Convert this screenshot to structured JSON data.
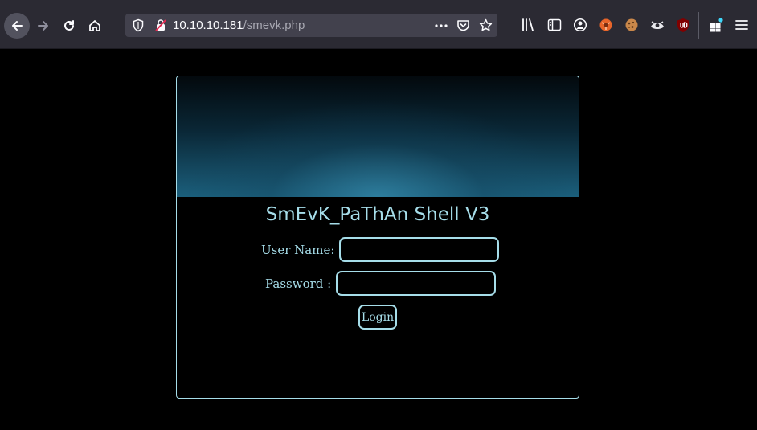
{
  "browser": {
    "url_host": "10.10.10.181",
    "url_path": "/smevk.php"
  },
  "login": {
    "title": "SmEvK_PaThAn Shell V3",
    "username_label": "User Name:",
    "username_value": "",
    "password_label": "Password :",
    "password_value": "",
    "login_label": "Login"
  },
  "colors": {
    "accent": "#a6dde9",
    "toolbar": "#2b2a33",
    "urlbar": "#42414d",
    "page_bg": "#000000"
  }
}
